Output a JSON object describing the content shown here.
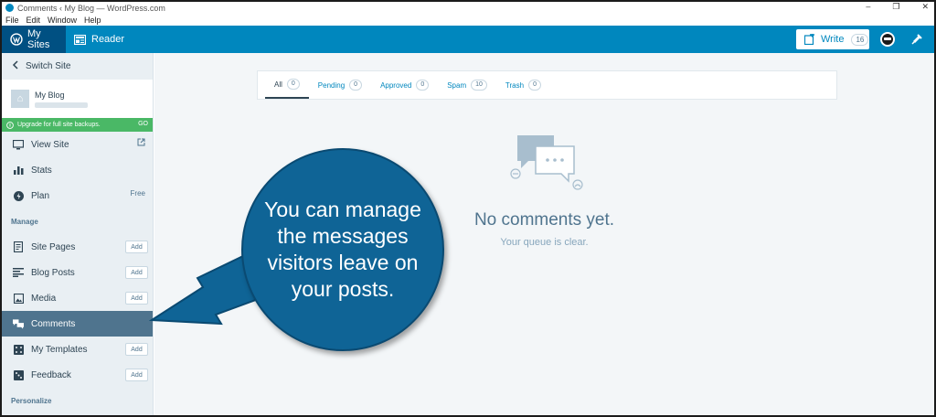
{
  "window": {
    "title": "Comments ‹ My Blog — WordPress.com",
    "menu": [
      "File",
      "Edit",
      "Window",
      "Help"
    ],
    "controls": [
      "–",
      "❐",
      "✕"
    ]
  },
  "masterbar": {
    "my_sites": "My Sites",
    "reader": "Reader",
    "write": "Write",
    "write_count": "16"
  },
  "sidebar": {
    "switch_site": "Switch Site",
    "site_name": "My Blog",
    "upgrade_text": "Upgrade for full site backups.",
    "upgrade_go": "GO",
    "view_site": "View Site",
    "stats": "Stats",
    "plan": "Plan",
    "plan_badge": "Free",
    "manage_heading": "Manage",
    "items": [
      {
        "label": "Site Pages",
        "action": "Add"
      },
      {
        "label": "Blog Posts",
        "action": "Add"
      },
      {
        "label": "Media",
        "action": "Add"
      },
      {
        "label": "Comments",
        "action": ""
      },
      {
        "label": "My Templates",
        "action": "Add"
      },
      {
        "label": "Feedback",
        "action": "Add"
      }
    ],
    "personalize_heading": "Personalize"
  },
  "filters": [
    {
      "label": "All",
      "count": "0"
    },
    {
      "label": "Pending",
      "count": "0"
    },
    {
      "label": "Approved",
      "count": "0"
    },
    {
      "label": "Spam",
      "count": "10"
    },
    {
      "label": "Trash",
      "count": "0"
    }
  ],
  "empty_state": {
    "title": "No comments yet.",
    "subtitle": "Your queue is clear."
  },
  "callout": {
    "text": "You can manage the messages visitors leave on your posts."
  },
  "colors": {
    "masterbar": "#0087be",
    "masterbar_active": "#005082",
    "upgrade_green": "#4ab866",
    "sidebar_active": "#4f748e",
    "callout_blue": "#0f6496"
  }
}
